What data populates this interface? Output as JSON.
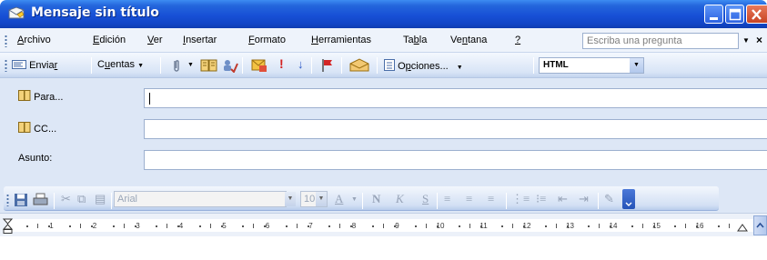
{
  "window": {
    "title": "Mensaje sin título",
    "controls": [
      "minimize-icon",
      "maximize-icon",
      "close-icon"
    ]
  },
  "menu": {
    "items": [
      {
        "pre": "",
        "u": "A",
        "post": "rchivo"
      },
      {
        "pre": "",
        "u": "E",
        "post": "dición"
      },
      {
        "pre": "",
        "u": "V",
        "post": "er"
      },
      {
        "pre": "",
        "u": "I",
        "post": "nsertar"
      },
      {
        "pre": "",
        "u": "F",
        "post": "ormato"
      },
      {
        "pre": "",
        "u": "H",
        "post": "erramientas"
      },
      {
        "pre": "Ta",
        "u": "b",
        "post": "la"
      },
      {
        "pre": "Ve",
        "u": "n",
        "post": "tana"
      },
      {
        "pre": "",
        "u": "?",
        "post": ""
      }
    ],
    "ask_placeholder": "Escriba una pregunta"
  },
  "toolbar": {
    "send_pre": "Envia",
    "send_u": "r",
    "accounts_pre": "C",
    "accounts_u": "u",
    "accounts_post": "entas",
    "options_pre": "O",
    "options_u": "p",
    "options_post": "ciones...",
    "format_value": "HTML"
  },
  "headers": {
    "to_label": "Para...",
    "cc_label": "CC...",
    "subject_label": "Asunto:",
    "to_value": "",
    "cc_value": "",
    "subject_value": ""
  },
  "format_toolbar": {
    "font_name": "Arial",
    "font_size": "10",
    "bold": "N",
    "italic": "K",
    "underline": "S"
  },
  "ruler": {
    "numbers": [
      "1",
      "2",
      "3",
      "4",
      "5",
      "6",
      "7",
      "8",
      "9",
      "10",
      "11",
      "12",
      "13",
      "14",
      "15",
      "16"
    ]
  },
  "colors": {
    "titlebar": "#1750d6",
    "toolbar": "#d8e4f6",
    "header_panel": "#dde7f6"
  }
}
